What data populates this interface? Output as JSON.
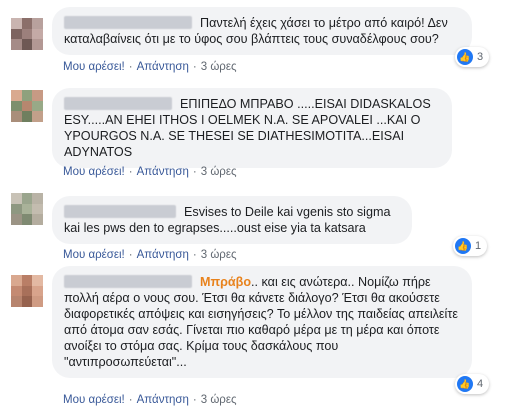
{
  "actions": {
    "like": "Μου αρέσει!",
    "reply": "Απάντηση",
    "separator": "·"
  },
  "comments": [
    {
      "text_before": "",
      "text": "Παντελή έχεις χάσει το μέτρο από καιρό! Δεν καταλαβαίνεις ότι με το ύφος σου βλάπτεις τους συναδέλφους σου?",
      "time": "3 ώρες",
      "reactions": "3"
    },
    {
      "text_before": "",
      "text": "ΕΠΙΠΕΔΟ ΜΠΡΑΒΟ .....EISAI DIDASKALOS ESY.....AN EHEI ITHOS I OELMEK N.A. SE APOVALEI ...KAI O YPOURGOS N.A. SE THESEI SE DIATHESIMOTITA...EISAI ADYNATOS",
      "time": "3 ώρες",
      "reactions": ""
    },
    {
      "text_before": "",
      "text": "Esvises to Deile kai vgenis sto sigma kai les pws den to egrapses.....oust eise yia ta katsara",
      "time": "3 ώρες",
      "reactions": "1"
    },
    {
      "highlight": "Μπράβο",
      "text": ".. και εις ανώτερα.. Νομίζω πήρε πολλή αέρα ο νους σου. Έτσι θα κάνετε διάλογο? Έτσι θα ακούσετε διαφορετικές απόψεις και εισηγήσεις? Το μέλλον της παιδείας απειλείτε από άτομα σαν εσάς. Γίνεται πιο καθαρό μέρα με τη μέρα και όποτε ανοίξει το στόμα σας. Κρίμα τους δασκάλους που \"αντιπροσωπεύεται\"...",
      "time": "3 ώρες",
      "reactions": "4"
    }
  ],
  "icons": {
    "like": "thumbs-up-icon"
  },
  "colors": {
    "link": "#385898",
    "bubble": "#f2f3f5",
    "highlight": "#e8821c",
    "like": "#2078f4"
  }
}
